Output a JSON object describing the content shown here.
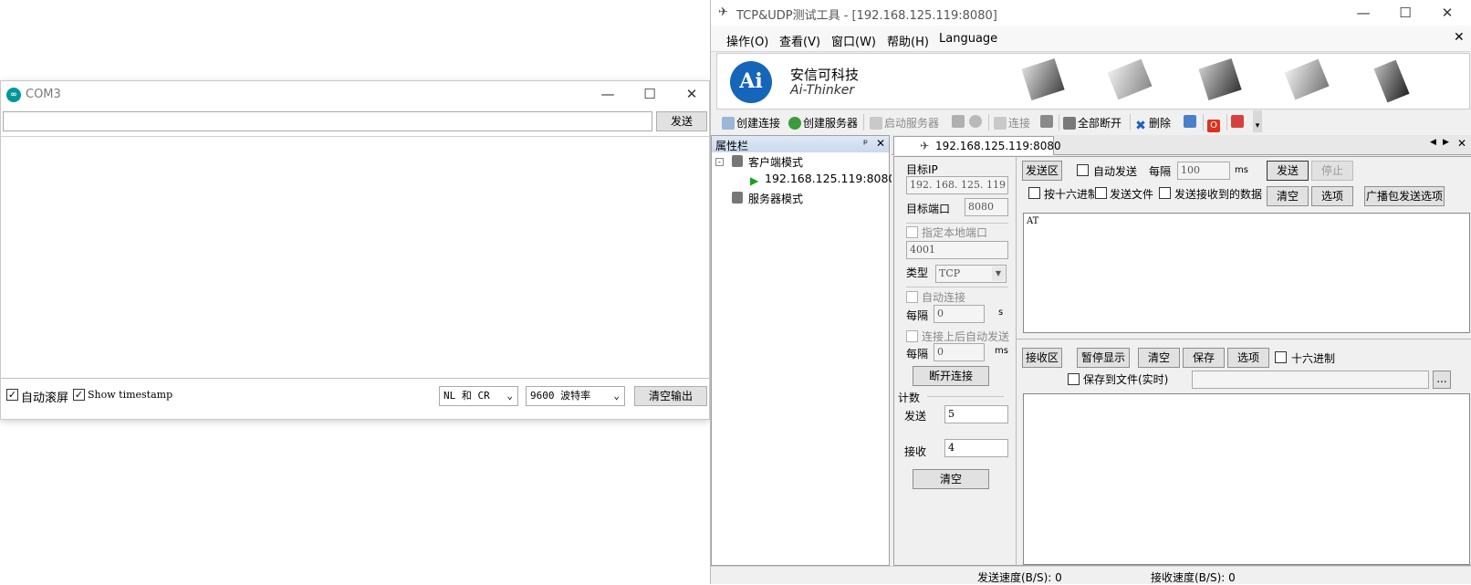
{
  "com3": {
    "title": "COM3",
    "send_button": "发送",
    "send_input": "",
    "autoscroll_label": "自动滚屏",
    "timestamp_label": "Show timestamp",
    "line_ending": "NL 和 CR",
    "baud": "9600 波特率",
    "clear_output": "清空输出"
  },
  "tcp": {
    "title": "TCP&UDP测试工具 - [192.168.125.119:8080]",
    "menu": [
      "操作(O)",
      "查看(V)",
      "窗口(W)",
      "帮助(H)",
      "Language"
    ],
    "brand_cn": "安信可科技",
    "brand_en": "Ai-Thinker",
    "logo_text": "Ai",
    "toolbar": {
      "create_conn": "创建连接",
      "create_server": "创建服务器",
      "start_server": "启动服务器",
      "connect": "连接",
      "disconnect_all": "全部断开",
      "delete": "删除"
    },
    "props_title": "属性栏",
    "tree": {
      "client_mode": "客户端模式",
      "client_item": "192.168.125.119:8080",
      "server_mode": "服务器模式"
    },
    "tab_label": "192.168.125.119:8080",
    "target_ip_label": "目标IP",
    "target_ip": "192. 168. 125. 119",
    "target_port_label": "目标端口",
    "target_port": "8080",
    "local_port_label": "指定本地端口",
    "local_port": "4001",
    "type_label": "类型",
    "type_value": "TCP",
    "auto_connect_label": "自动连接",
    "interval_label": "每隔",
    "interval_value": "0",
    "interval_unit_s": "s",
    "auto_send_after_label": "连接上后自动发送",
    "interval2_value": "0",
    "interval_unit_ms": "ms",
    "disconnect_btn": "断开连接",
    "count_label": "计数",
    "send_count_label": "发送",
    "send_count": "5",
    "recv_count_label": "接收",
    "recv_count": "4",
    "clear_count_btn": "清空",
    "send_area": {
      "label": "发送区",
      "auto_send": "自动发送",
      "interval_label": "每隔",
      "interval_value": "100",
      "unit": "ms",
      "send_btn": "发送",
      "stop_btn": "停止",
      "hex": "按十六进制",
      "send_file": "发送文件",
      "send_received": "发送接收到的数据",
      "clear_btn": "清空",
      "options_btn": "选项",
      "broadcast_btn": "广播包发送选项",
      "content": "AT"
    },
    "recv_area": {
      "label": "接收区",
      "pause_btn": "暂停显示",
      "clear_btn": "清空",
      "save_btn": "保存",
      "options_btn": "选项",
      "hex": "十六进制",
      "save_file": "保存到文件(实时)",
      "browse": "...",
      "content": ""
    },
    "status": {
      "send_speed": "发送速度(B/S): 0",
      "recv_speed": "接收速度(B/S): 0"
    }
  }
}
